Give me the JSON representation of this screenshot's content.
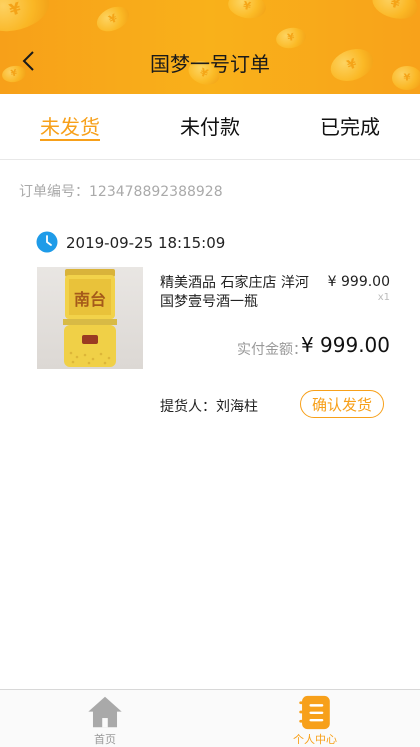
{
  "header": {
    "title": "国梦一号订单",
    "coin_symbol": "¥",
    "background": "#f8a81a"
  },
  "tabs": [
    {
      "label": "未发货",
      "active": true
    },
    {
      "label": "未付款",
      "active": false
    },
    {
      "label": "已完成",
      "active": false
    }
  ],
  "order": {
    "number_text": "订单编号：123478892388928",
    "datetime": "2019-09-25  18:15:09",
    "product": {
      "name": "精美酒品 石家庄店 洋河国梦壹号酒一瓶",
      "price": "¥ 999.00",
      "quantity": "x1",
      "image_text": "南台"
    },
    "paid_label": "实付金额：",
    "paid_amount": "¥ 999.00",
    "picker": "提货人：刘海柱",
    "confirm_button": "确认发货"
  },
  "bottom_nav": [
    {
      "label": "首页",
      "icon": "home-icon",
      "active": false
    },
    {
      "label": "个人中心",
      "icon": "profile-list-icon",
      "active": true
    }
  ],
  "colors": {
    "accent": "#f7a01a",
    "muted": "#aaaaaa",
    "clock": "#1e9be8"
  }
}
